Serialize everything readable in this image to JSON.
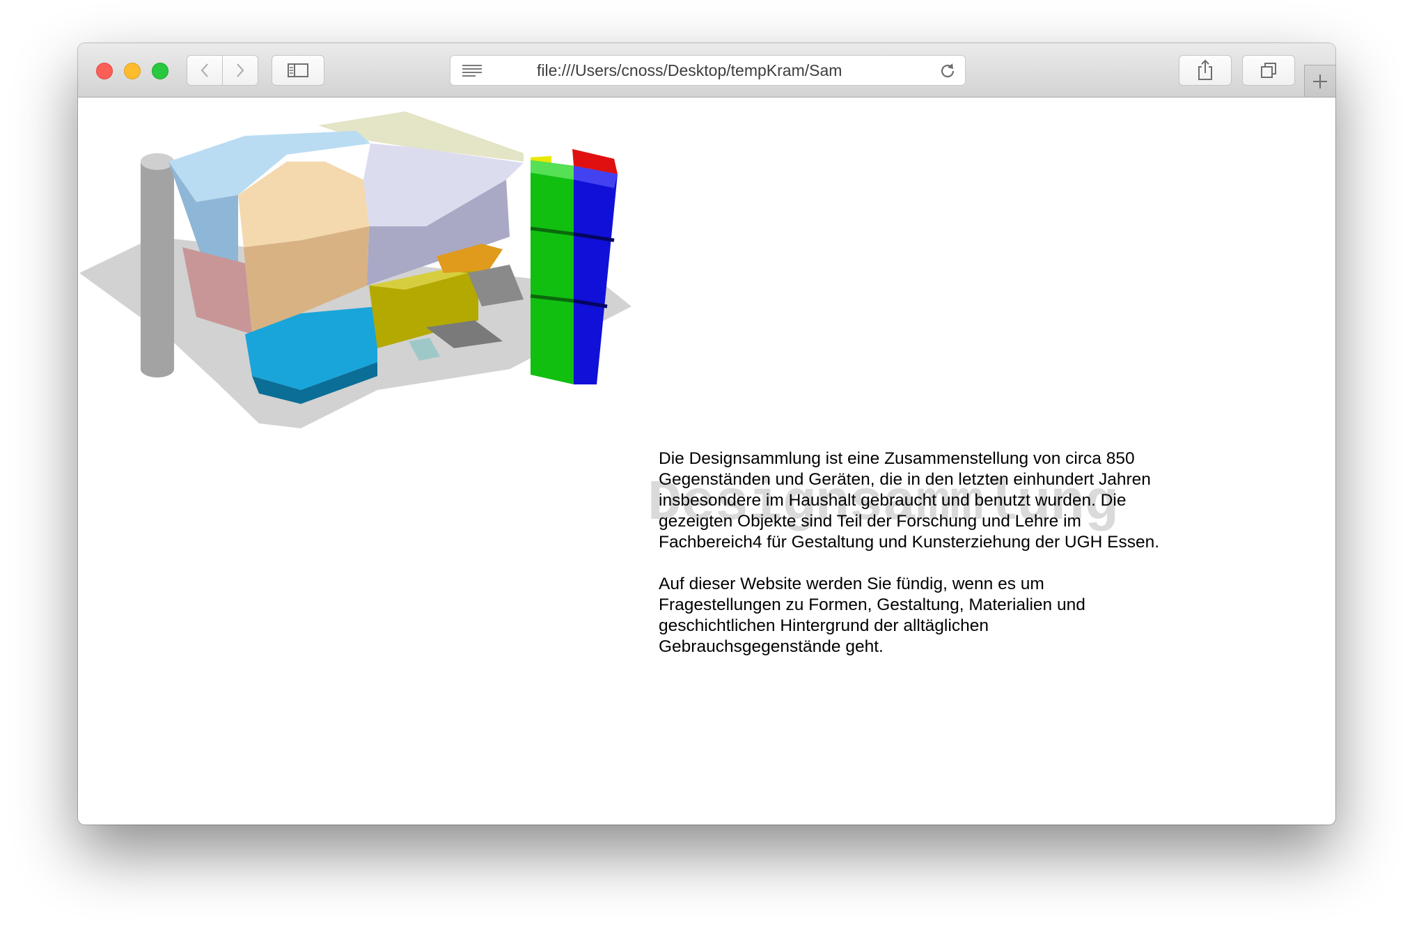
{
  "browser": {
    "address_bar": {
      "url": "file:///Users/cnoss/Desktop/tempKram/Sam"
    },
    "icons": {
      "back": "chevron-left-icon",
      "forward": "chevron-right-icon",
      "sidebar": "sidebar-icon",
      "reader": "reader-list-icon",
      "reload": "reload-icon",
      "share": "share-icon",
      "tabs": "tabs-overview-icon",
      "new_tab": "plus-icon"
    },
    "traffic_light_colors": {
      "close": "#fc5f57",
      "minimize": "#fdbc2e",
      "maximize": "#28c840"
    }
  },
  "page": {
    "watermark": "Designsammlung",
    "paragraphs": [
      "Die Designsammlung ist eine Zusammenstellung von circa 850 Gegenständen und Geräten, die in den letzten einhundert Jahren insbesondere im Haushalt gebraucht und benutzt wurden. Die gezeigten Objekte sind Teil der Forschung und Lehre im Fachbereich4 für Gestaltung und Kunsterziehung der UGH Essen.",
      "Auf dieser Website werden Sie fündig, wenn es um Fragestellungen zu Formen, Gestaltung, Materialien und geschichtlichen Hintergrund der alltäglichen Gebrauchsgegenstände geht."
    ]
  }
}
